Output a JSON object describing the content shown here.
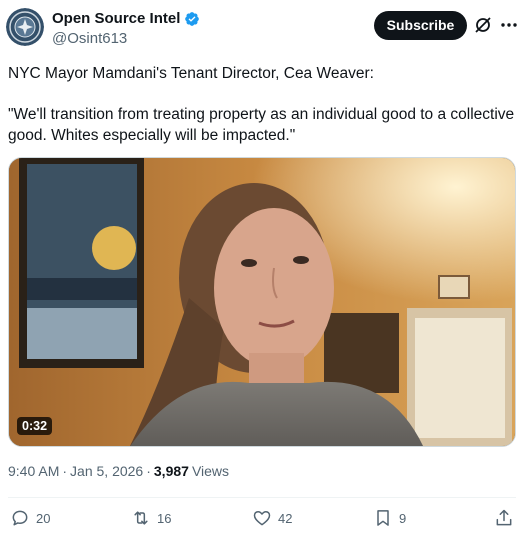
{
  "account": {
    "display_name": "Open Source Intel",
    "handle": "@Osint613",
    "verified_color": "#1d9bf0"
  },
  "header": {
    "subscribe_label": "Subscribe"
  },
  "tweet": {
    "line1": "NYC Mayor Mamdani's Tenant Director, Cea Weaver:",
    "line2": "\"We'll transition from treating property as an individual good to a collective good. Whites especially will be impacted.\""
  },
  "media": {
    "duration": "0:32"
  },
  "meta": {
    "time": "9:40 AM",
    "sep1": "·",
    "date": "Jan 5, 2026",
    "sep2": "·",
    "views_count": "3,987",
    "views_label": "Views"
  },
  "actions": {
    "replies": "20",
    "reposts": "16",
    "likes": "42",
    "bookmarks": "9"
  },
  "icons": [
    "verified-badge-icon",
    "grok-icon",
    "more-icon",
    "reply-icon",
    "repost-icon",
    "like-icon",
    "bookmark-icon",
    "share-icon"
  ]
}
